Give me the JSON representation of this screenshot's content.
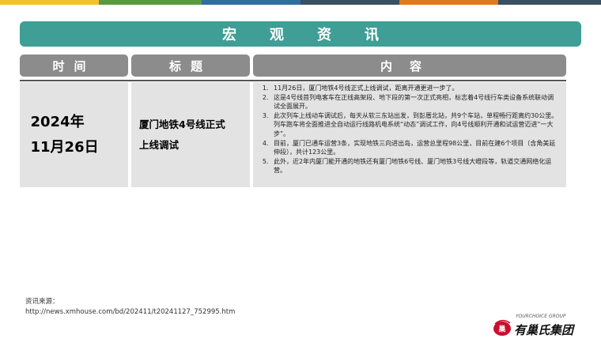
{
  "banner": {
    "title": "宏观资讯"
  },
  "table": {
    "headers": {
      "time": "时间",
      "title": "标题",
      "content": "内容"
    },
    "row": {
      "date_line1": "2024年",
      "date_line2": "11月26日",
      "title_line1": "厦门地铁4号线正式",
      "title_line2": "上线调试",
      "items": [
        "11月26日，厦门地铁4号线正式上线调试，距离开通更进一步了。",
        "这是4号线首列电客车在正线高架段、地下段的第一次正式亮相，标志着4号线行车类设备系统联动调试全面展开。",
        "此次列车上线动车调试后，每天从软三东站出发，到彭厝北站，共9个车站，单程畅行距离约30公里。列车跑车将全面推进全自动运行线路机电系统“动态”调试工作，向4号线顺利开通和试运营迈进“一大步”。",
        "目前，厦门已通车运营3条，实现地铁三向进出岛，运营总里程98公里，目前在建6个项目（含角美延伸段），共计123公里。",
        "此外，近2年内厦门能开通的地铁还有厦门地铁6号线、厦门地铁3号线大嶝段等，轨道交通网络化运营。"
      ]
    }
  },
  "source": {
    "label": "资讯来源：",
    "url": "http://news.xmhouse.com/bd/202411/t20241127_752995.htm"
  },
  "logo": {
    "english": "YOURCHOICE GROUP",
    "chinese": "有巢氏集团",
    "mark_text": "巢"
  },
  "colors": {
    "stripe": [
      "#f2c12e",
      "#5a9a3c",
      "#2f6f9e",
      "#3a4f63",
      "#e07a1f",
      "#2f6f9e",
      "#3a4f63"
    ],
    "banner": "#3f9e95",
    "header": "#8c8c8c",
    "cell": "#e3e3e3",
    "logo_red": "#c8102e"
  }
}
